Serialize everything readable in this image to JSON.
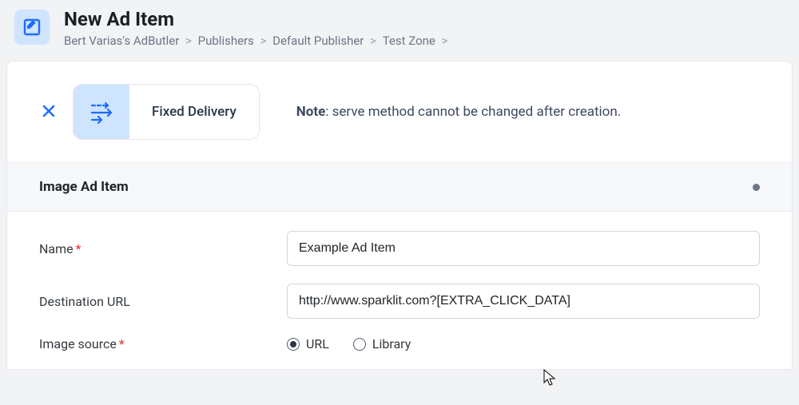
{
  "header": {
    "title": "New Ad Item",
    "breadcrumb": [
      "Bert Varias's AdButler",
      "Publishers",
      "Default Publisher",
      "Test Zone"
    ]
  },
  "serve": {
    "chip_label": "Fixed Delivery",
    "note_label": "Note",
    "note_text": ": serve method cannot be changed after creation."
  },
  "section": {
    "title": "Image Ad Item"
  },
  "form": {
    "name_label": "Name",
    "name_value": "Example Ad Item",
    "dest_label": "Destination URL",
    "dest_value": "http://www.sparklit.com?[EXTRA_CLICK_DATA]",
    "source_label": "Image source",
    "source_url": "URL",
    "source_library": "Library",
    "source_selected": "url"
  },
  "icons": {
    "edit": "edit-icon",
    "arrows": "serve-arrows-icon"
  }
}
